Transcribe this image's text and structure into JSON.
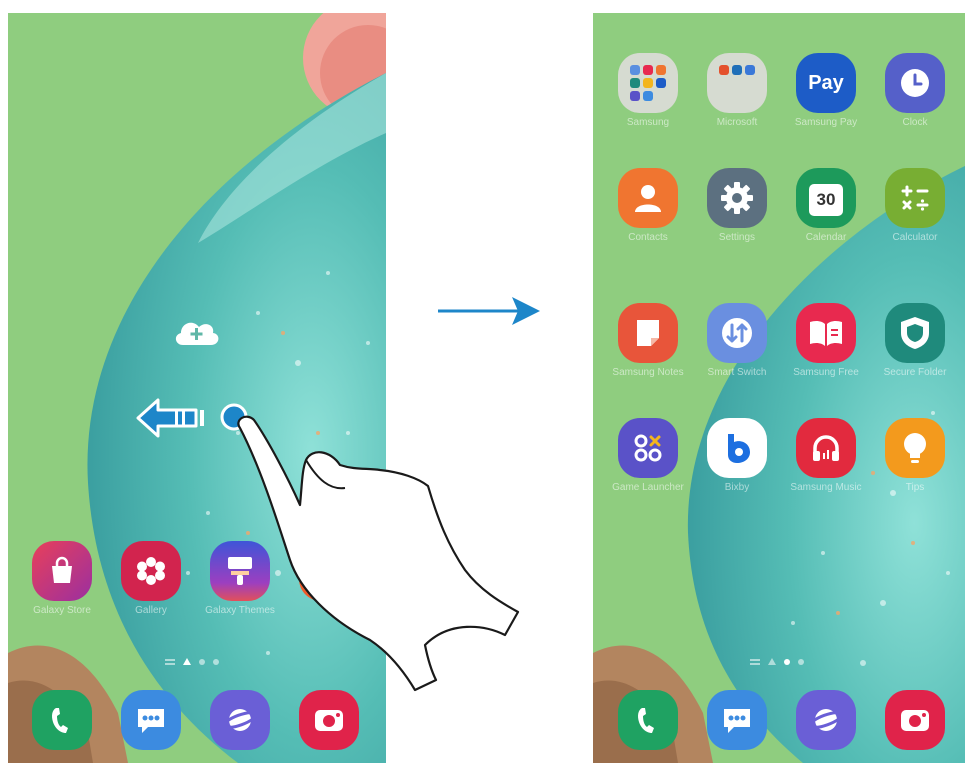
{
  "left_screen": {
    "home_widget_icon": "cloud-add-icon",
    "apps": [
      {
        "icon": "galaxy-store-icon",
        "label": "Galaxy Store",
        "color": "#c1307a"
      },
      {
        "icon": "gallery-icon",
        "label": "Gallery",
        "color": "#d2244e"
      },
      {
        "icon": "galaxy-themes-icon",
        "label": "Galaxy Themes",
        "color": "#4a4fd0"
      },
      {
        "icon": "partial-app-icon",
        "label": "",
        "color": "#f05a2a"
      }
    ],
    "dock": [
      {
        "icon": "phone-icon",
        "label": "Phone",
        "color": "#1fa262"
      },
      {
        "icon": "messages-icon",
        "label": "Messages",
        "color": "#3c8be0"
      },
      {
        "icon": "internet-icon",
        "label": "Internet",
        "color": "#6a5fd6"
      },
      {
        "icon": "camera-icon",
        "label": "Camera",
        "color": "#e0234a"
      }
    ],
    "gesture": "swipe-left"
  },
  "right_screen": {
    "apps": [
      {
        "icon": "samsung-folder-icon",
        "label": "Samsung",
        "color": "#d6dbd1"
      },
      {
        "icon": "microsoft-folder-icon",
        "label": "Microsoft",
        "color": "#d6dbd1"
      },
      {
        "icon": "samsung-pay-icon",
        "label": "Samsung Pay",
        "color": "#1d5cc7",
        "text": "Pay"
      },
      {
        "icon": "clock-icon",
        "label": "Clock",
        "color": "#5560c9"
      },
      {
        "icon": "contacts-icon",
        "label": "Contacts",
        "color": "#f07530"
      },
      {
        "icon": "settings-icon",
        "label": "Settings",
        "color": "#5c7080"
      },
      {
        "icon": "calendar-icon",
        "label": "Calendar",
        "color": "#1d9a5b",
        "text": "30"
      },
      {
        "icon": "calculator-icon",
        "label": "Calculator",
        "color": "#78ae33"
      },
      {
        "icon": "samsung-notes-icon",
        "label": "Samsung Notes",
        "color": "#e8553a"
      },
      {
        "icon": "smart-switch-icon",
        "label": "Smart Switch",
        "color": "#6a8fe0"
      },
      {
        "icon": "samsung-free-icon",
        "label": "Samsung Free",
        "color": "#e8294f"
      },
      {
        "icon": "secure-folder-icon",
        "label": "Secure Folder",
        "color": "#1f8a7c"
      },
      {
        "icon": "game-launcher-icon",
        "label": "Game Launcher",
        "color": "#5a52c8"
      },
      {
        "icon": "bixby-icon",
        "label": "Bixby",
        "color": "#ffffff"
      },
      {
        "icon": "samsung-music-icon",
        "label": "Samsung Music",
        "color": "#e22a3e"
      },
      {
        "icon": "tips-icon",
        "label": "Tips",
        "color": "#f39a1d"
      }
    ],
    "dock": [
      {
        "icon": "phone-icon",
        "label": "Phone",
        "color": "#1fa262"
      },
      {
        "icon": "messages-icon",
        "label": "Messages",
        "color": "#3c8be0"
      },
      {
        "icon": "internet-icon",
        "label": "Internet",
        "color": "#6a5fd6"
      },
      {
        "icon": "camera-icon",
        "label": "Camera",
        "color": "#e0234a"
      }
    ]
  },
  "transition_arrow": "right-arrow-icon",
  "colors": {
    "wallpaper_green": "#8fcd7f",
    "bubble_teal": "#62c4bd",
    "arrow_blue": "#1d86c9"
  }
}
